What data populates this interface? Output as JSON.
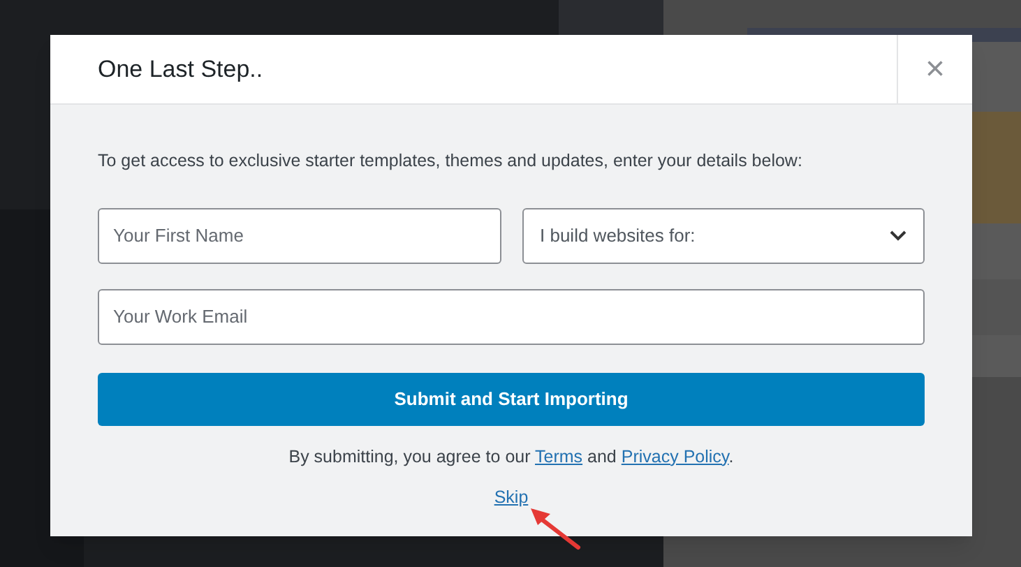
{
  "dialog": {
    "title": "One Last Step..",
    "close": "×",
    "intro": "To get access to exclusive starter templates, themes and updates, enter your details below:",
    "fields": [
      {
        "kind": "text",
        "placeholder": "Your First Name"
      },
      {
        "kind": "select",
        "placeholder": "I build websites for:"
      },
      {
        "kind": "text",
        "placeholder": "Your Work Email"
      }
    ],
    "submit": "Submit and Start Importing",
    "agreement": {
      "before": "By submitting, you agree to our",
      "terms": "Terms",
      "middle": "and",
      "privacy": "Privacy Policy",
      "after": "."
    },
    "skip": "Skip"
  },
  "annotation": {
    "kind": "arrow"
  }
}
